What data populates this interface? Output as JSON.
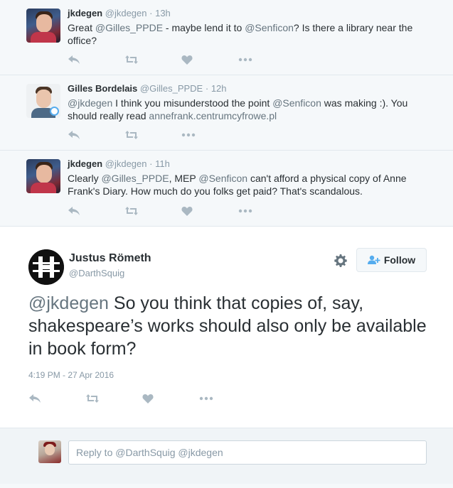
{
  "tweets": [
    {
      "fullname": "jkdegen",
      "screenname": "@jkdegen",
      "time": "13h",
      "segments": [
        {
          "type": "text",
          "value": "Great "
        },
        {
          "type": "mention",
          "value": "@Gilles_PPDE"
        },
        {
          "type": "text",
          "value": " - maybe lend it to "
        },
        {
          "type": "mention",
          "value": "@Senficon"
        },
        {
          "type": "text",
          "value": "? Is there a library near the office?"
        }
      ]
    },
    {
      "fullname": "Gilles Bordelais",
      "screenname": "@Gilles_PPDE",
      "time": "12h",
      "segments": [
        {
          "type": "mention",
          "value": "@jkdegen"
        },
        {
          "type": "text",
          "value": " I think you misunderstood the point "
        },
        {
          "type": "mention",
          "value": "@Senficon"
        },
        {
          "type": "text",
          "value": " was making :). You should really read "
        },
        {
          "type": "link",
          "value": "annefrank.centrumcyfrowe.pl"
        }
      ]
    },
    {
      "fullname": "jkdegen",
      "screenname": "@jkdegen",
      "time": "11h",
      "segments": [
        {
          "type": "text",
          "value": "Clearly "
        },
        {
          "type": "mention",
          "value": "@Gilles_PPDE"
        },
        {
          "type": "text",
          "value": ", MEP "
        },
        {
          "type": "mention",
          "value": "@Senficon"
        },
        {
          "type": "text",
          "value": " can't afford a physical copy of Anne Frank's Diary. How much do you folks get paid? That's scandalous."
        }
      ]
    }
  ],
  "permalink": {
    "fullname": "Justus Römeth",
    "screenname": "@DarthSquig",
    "follow_label": "Follow",
    "segments": [
      {
        "type": "mention",
        "value": "@jkdegen"
      },
      {
        "type": "text",
        "value": " So you think that copies of, say, shakespeare’s works should also only be available in book form?"
      }
    ],
    "timestamp": "4:19 PM - 27 Apr 2016"
  },
  "reply": {
    "placeholder": "Reply to @DarthSquig @jkdegen"
  },
  "colors": {
    "accent": "#55acee",
    "muted": "#8899a6",
    "text": "#292f33",
    "mention": "#66757f",
    "action_icon": "#aab8c2"
  },
  "icons": [
    "reply-icon",
    "retweet-icon",
    "like-icon",
    "more-icon",
    "gear-icon",
    "follow-person-icon"
  ]
}
